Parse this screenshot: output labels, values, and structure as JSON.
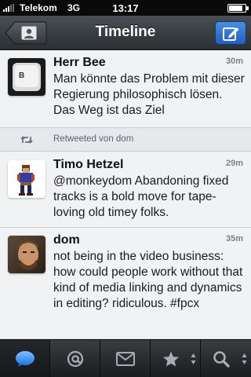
{
  "status_bar": {
    "carrier": "Telekom",
    "network": "3G",
    "time": "13:17",
    "battery_level": 0.85
  },
  "nav": {
    "title": "Timeline",
    "back_icon": "person-icon",
    "compose_icon": "compose-icon"
  },
  "tweets": [
    {
      "name": "Herr Bee",
      "age": "30m",
      "text": "Man könnte das Problem mit dieser Regierung philosophisch lösen. Das Weg ist das Ziel",
      "avatar": "keyboard-key-b"
    },
    {
      "name": "Timo Hetzel",
      "age": "29m",
      "text": "@monkeydom Abandoning fixed tracks is a bold move for tape-loving old timey folks.",
      "avatar": "pixel-pirate"
    },
    {
      "name": "dom",
      "age": "35m",
      "text": "not being in the video business: how could people work without that kind of media linking and dynamics in editing? ridiculous. #fpcx",
      "avatar": "photo-man"
    }
  ],
  "retweet_note": "Retweeted von dom",
  "tabs": [
    {
      "icon": "speech-bubble-icon",
      "active": true
    },
    {
      "icon": "at-sign-icon",
      "active": false
    },
    {
      "icon": "envelope-icon",
      "active": false
    },
    {
      "icon": "star-icon",
      "active": false
    },
    {
      "icon": "search-icon",
      "active": false
    }
  ],
  "colors": {
    "accent": "#2f6fd0",
    "nav_bg": "#3a3e43",
    "timeline_bg": "#f1f2f4"
  }
}
